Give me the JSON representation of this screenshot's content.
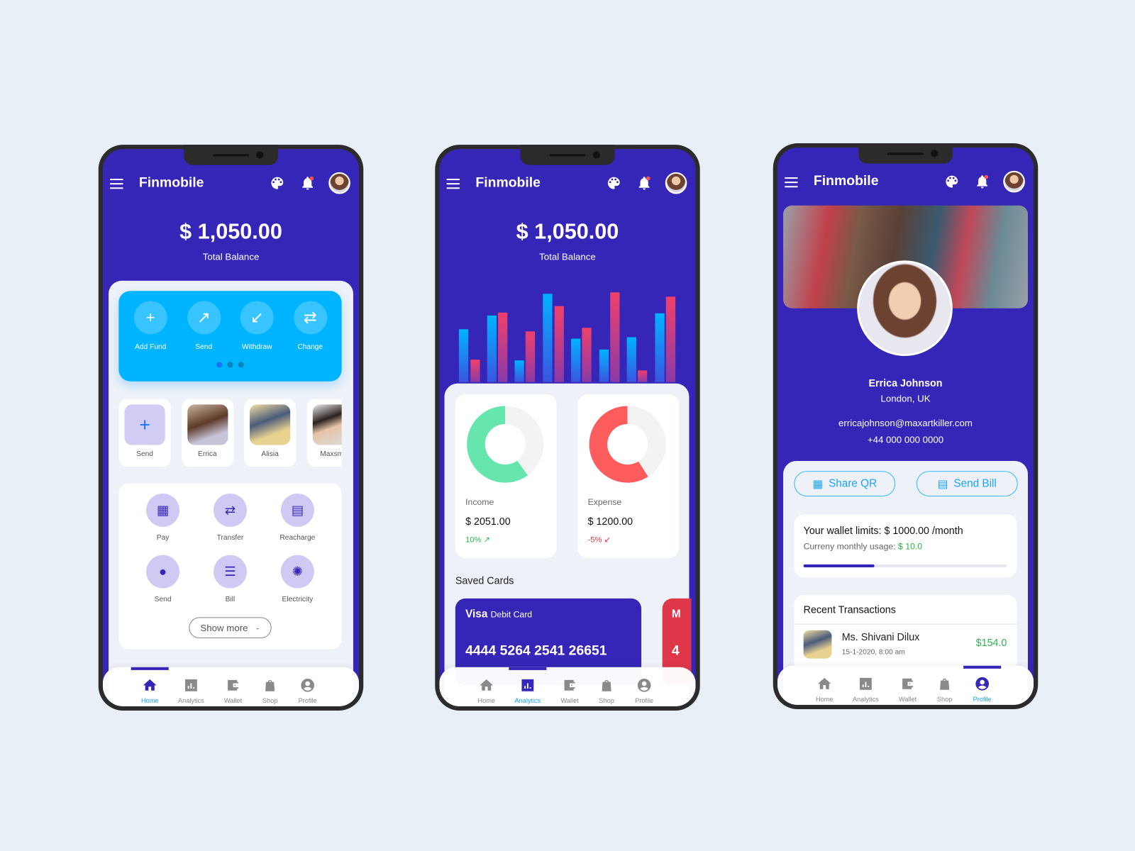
{
  "app": {
    "title": "Finmobile"
  },
  "balance": {
    "amount": "$ 1,050.00",
    "label": "Total Balance"
  },
  "home": {
    "quick_actions": [
      {
        "label": "Add Fund",
        "icon": "plus-icon"
      },
      {
        "label": "Send",
        "icon": "arrow-up-right-icon"
      },
      {
        "label": "Withdraw",
        "icon": "arrow-down-left-icon"
      },
      {
        "label": "Change",
        "icon": "swap-icon"
      }
    ],
    "carousel": {
      "pages": 3,
      "active": 1
    },
    "contacts": [
      {
        "label": "Send"
      },
      {
        "label": "Errica"
      },
      {
        "label": "Alisia"
      },
      {
        "label": "Maxsmi"
      }
    ],
    "services": [
      {
        "label": "Pay",
        "icon": "qr-code-icon"
      },
      {
        "label": "Transfer",
        "icon": "swap-icon"
      },
      {
        "label": "Reacharge",
        "icon": "sim-card-icon"
      },
      {
        "label": "Send",
        "icon": "user-icon"
      },
      {
        "label": "Bill",
        "icon": "receipt-icon"
      },
      {
        "label": "Electricity",
        "icon": "bulb-icon"
      }
    ],
    "show_more": "Show more"
  },
  "analytics": {
    "bars": {
      "blue": [
        73,
        92,
        30,
        122,
        60,
        45,
        62,
        95
      ],
      "pink": [
        31,
        96,
        70,
        105,
        75,
        124,
        16,
        118
      ]
    },
    "income": {
      "label": "Income",
      "amount": "$ 2051.00",
      "change": "10% ↗",
      "share": 0.6,
      "color": "#66e6ac"
    },
    "expense": {
      "label": "Expense",
      "amount": "$ 1200.00",
      "change": "-5% ↙",
      "share": 0.59,
      "color": "#fd5c5c"
    },
    "saved_cards_title": "Saved Cards",
    "cards": [
      {
        "brand": "Visa",
        "type": "Debit Card",
        "number": "4444 5264 2541 26651"
      },
      {
        "brand": "M",
        "number": "4"
      }
    ]
  },
  "profile": {
    "name": "Errica Johnson",
    "location": "London, UK",
    "email": "erricajohnson@maxartkiller.com",
    "phone": "+44 000 000 0000",
    "share_qr": "Share QR",
    "send_bill": "Send Bill",
    "wallet_limit": "Your wallet limits: $ 1000.00 /month",
    "usage_label": "Curreny monthly usage:",
    "usage_value": "$ 10.0",
    "usage_fraction": 0.35,
    "recent_title": "Recent Transactions",
    "transactions": [
      {
        "name": "Ms. Shivani Dilux",
        "date": "15-1-2020, 8:00 am",
        "amount": "$154.0"
      }
    ]
  },
  "nav": [
    "Home",
    "Analytics",
    "Wallet",
    "Shop",
    "Profile"
  ],
  "colors": {
    "primary": "#3626b8",
    "accent": "#00b4ff",
    "green": "#2fb34a",
    "red": "#e8363f"
  }
}
